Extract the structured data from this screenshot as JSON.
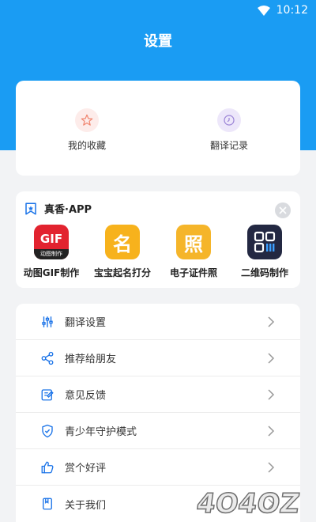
{
  "status": {
    "time": "10:12"
  },
  "header": {
    "title": "设置"
  },
  "quick_actions": [
    {
      "label": "我的收藏",
      "icon": "star-icon"
    },
    {
      "label": "翻译记录",
      "icon": "clock-icon"
    }
  ],
  "promo": {
    "title": "真香·APP",
    "apps": [
      {
        "label": "动图GIF制作",
        "icon": "gif-maker-icon",
        "badge": "GIF",
        "sub": "动图制作"
      },
      {
        "label": "宝宝起名打分",
        "icon": "baby-name-icon",
        "badge": "名"
      },
      {
        "label": "电子证件照",
        "icon": "id-photo-icon",
        "badge": "照"
      },
      {
        "label": "二维码制作",
        "icon": "qrcode-icon"
      }
    ]
  },
  "menu": [
    {
      "label": "翻译设置",
      "icon": "sliders-icon"
    },
    {
      "label": "推荐给朋友",
      "icon": "share-icon"
    },
    {
      "label": "意见反馈",
      "icon": "edit-icon"
    },
    {
      "label": "青少年守护模式",
      "icon": "shield-icon"
    },
    {
      "label": "赏个好评",
      "icon": "thumbs-up-icon"
    },
    {
      "label": "关于我们",
      "icon": "about-icon"
    }
  ],
  "watermark": {
    "text": "4O4OZ"
  },
  "colors": {
    "primary": "#1a9cf3",
    "background": "#f2f3f5",
    "card": "#ffffff"
  }
}
